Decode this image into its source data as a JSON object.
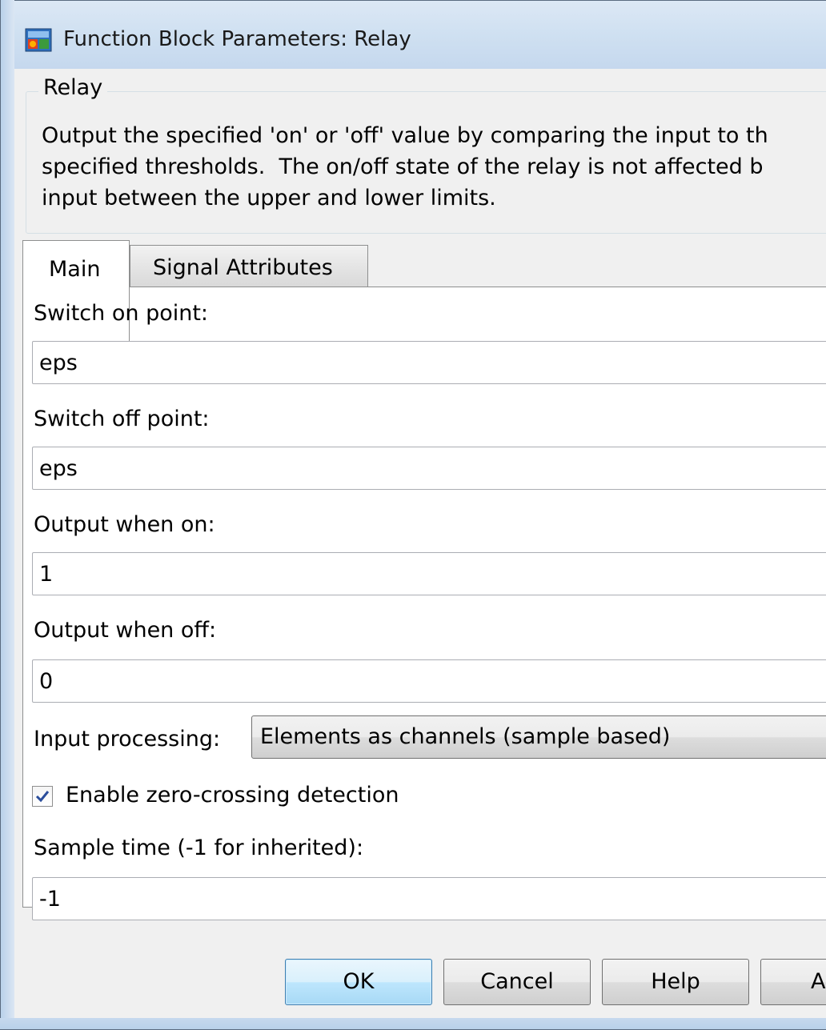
{
  "window": {
    "title": "Function Block Parameters: Relay",
    "icon": "simulink-block-icon"
  },
  "group": {
    "title": "Relay",
    "description": "Output the specified 'on' or 'off' value by comparing the input to th\nspecified thresholds.  The on/off state of the relay is not affected b\ninput between the upper and lower limits."
  },
  "tabs": [
    {
      "label": "Main",
      "selected": true
    },
    {
      "label": "Signal Attributes",
      "selected": false
    }
  ],
  "fields": {
    "switch_on": {
      "label": "Switch on point:",
      "value": "eps"
    },
    "switch_off": {
      "label": "Switch off point:",
      "value": "eps"
    },
    "output_on": {
      "label": "Output when on:",
      "value": "1"
    },
    "output_off": {
      "label": "Output when off:",
      "value": "0"
    },
    "input_processing": {
      "label": "Input processing:",
      "value": "Elements as channels (sample based)"
    },
    "zero_crossing": {
      "label": "Enable zero-crossing detection",
      "checked": true
    },
    "sample_time": {
      "label": "Sample time (-1 for inherited):",
      "value": "-1"
    }
  },
  "buttons": {
    "ok": "OK",
    "cancel": "Cancel",
    "help": "Help",
    "apply": "Ap"
  },
  "colors": {
    "dialog_bg": "#f0f0f0",
    "frame": "#c5d8ee",
    "ok_border": "#3c7fb1"
  }
}
